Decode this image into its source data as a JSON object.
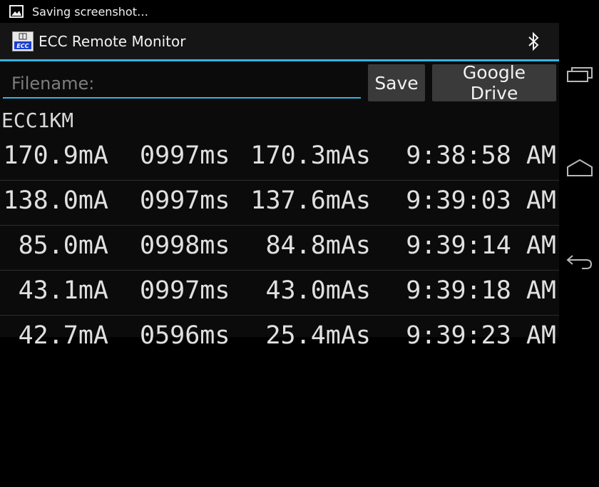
{
  "status_bar": {
    "text": "Saving screenshot…"
  },
  "action_bar": {
    "title": "ECC Remote Monitor"
  },
  "form": {
    "filename_placeholder": "Filename:",
    "filename_value": "",
    "save_label": "Save",
    "drive_label": "Google Drive"
  },
  "device": {
    "name": "ECC1KM"
  },
  "readings": [
    {
      "current": "170.9mA",
      "duration": "0997ms",
      "charge": "170.3mAs",
      "time": "9:38:58 AM"
    },
    {
      "current": "138.0mA",
      "duration": "0997ms",
      "charge": "137.6mAs",
      "time": "9:39:03 AM"
    },
    {
      "current": "85.0mA",
      "duration": "0998ms",
      "charge": "84.8mAs",
      "time": "9:39:14 AM"
    },
    {
      "current": "43.1mA",
      "duration": "0997ms",
      "charge": "43.0mAs",
      "time": "9:39:18 AM"
    },
    {
      "current": "42.7mA",
      "duration": "0596ms",
      "charge": "25.4mAs",
      "time": "9:39:23 AM"
    }
  ],
  "colors": {
    "accent": "#33b5e5",
    "button_bg": "#3a3a3a",
    "background": "#0b0b0b"
  },
  "icons": {
    "status": "image-icon",
    "app": "ecc-app-icon",
    "action": "bluetooth-icon",
    "nav": [
      "recent-apps-icon",
      "home-icon",
      "back-icon"
    ]
  }
}
